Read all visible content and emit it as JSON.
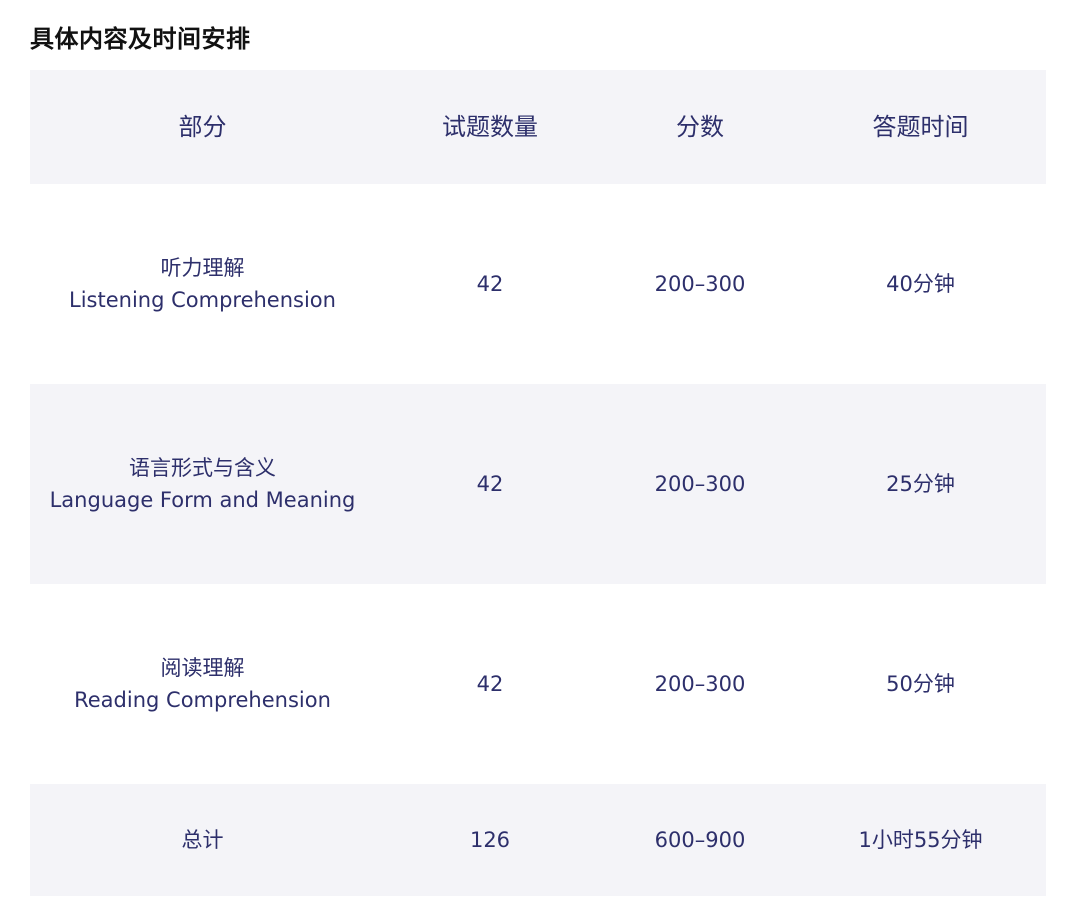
{
  "title": "具体内容及时间安排",
  "table": {
    "headers": [
      "部分",
      "试题数量",
      "分数",
      "答题时间"
    ],
    "rows": [
      {
        "part_zh": "听力理解",
        "part_en": "Listening Comprehension",
        "count": "42",
        "score": "200–300",
        "time": "40分钟"
      },
      {
        "part_zh": "语言形式与含义",
        "part_en": "Language Form and Meaning",
        "count": "42",
        "score": "200–300",
        "time": "25分钟"
      },
      {
        "part_zh": "阅读理解",
        "part_en": "Reading Comprehension",
        "count": "42",
        "score": "200–300",
        "time": "50分钟"
      }
    ],
    "total": {
      "label": "总计",
      "count": "126",
      "score": "600–900",
      "time": "1小时55分钟"
    }
  },
  "colors": {
    "text": "#2d2f6b",
    "title": "#111111",
    "shade": "#f4f4f8"
  }
}
